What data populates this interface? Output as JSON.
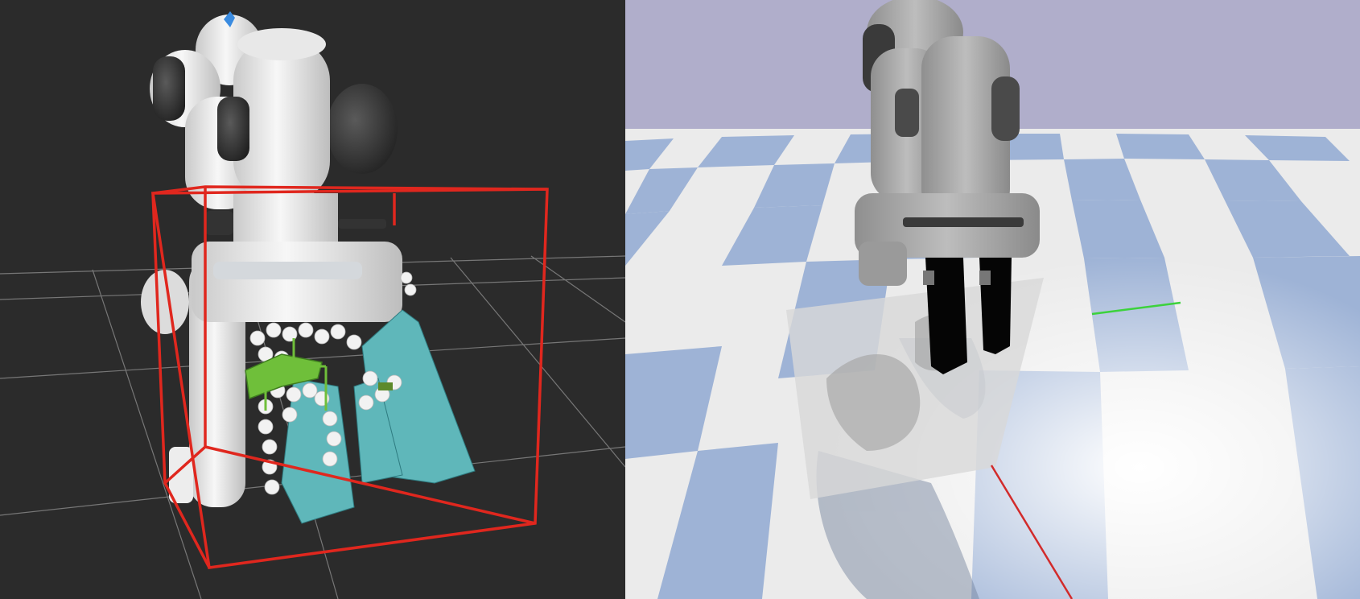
{
  "scene": {
    "left_panel": {
      "label": "",
      "background": "#2b2b2b",
      "grid_color": "#8a8a8a",
      "bounding_box_color": "#e0271e",
      "voxel_color": "#5fb7ba",
      "sphere_color": "#f2f2f2",
      "grasp_color": "#6fbf3a",
      "marker_color": "#3a8be0"
    },
    "right_panel": {
      "label": "",
      "sky_color": "#b0aecb",
      "floor_light": "#ebebeb",
      "floor_blue": "#9eb3d6",
      "axis_x_color": "#d22b2b",
      "axis_y_color": "#3cd23c"
    }
  }
}
